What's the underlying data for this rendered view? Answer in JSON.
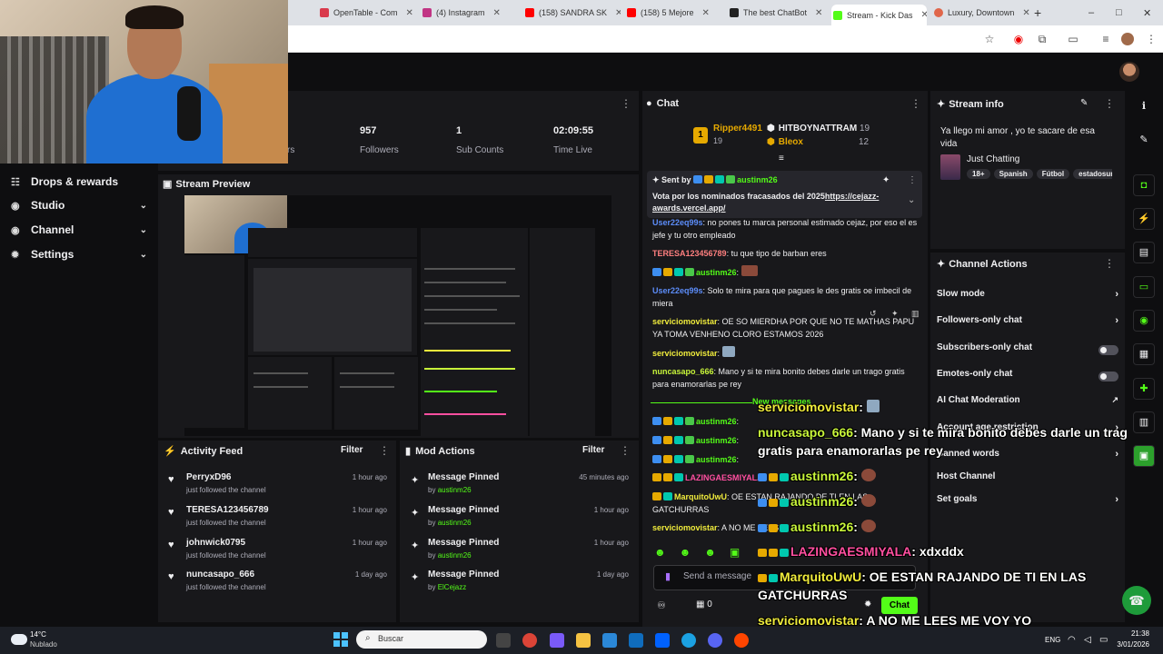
{
  "browser": {
    "tabs": [
      {
        "label": "OpenTable - Com",
        "color": "#d93a4c"
      },
      {
        "label": "(4) Instagram",
        "color": "#c13584"
      },
      {
        "label": "(158) SANDRA SK",
        "color": "#ff0000"
      },
      {
        "label": "(158) 5 Mejore",
        "color": "#ff0000"
      },
      {
        "label": "The best ChatBot",
        "color": "#222222"
      },
      {
        "label": "Stream - Kick Das",
        "color": "#53fc18"
      },
      {
        "label": "Luxury, Downtown",
        "color": "#e0664a"
      }
    ],
    "new_tab": "+",
    "window_controls": [
      "–",
      "□",
      "✕"
    ]
  },
  "sidebar": {
    "items": [
      {
        "label": "Drops & rewards",
        "icon": "gift-icon",
        "glyph": "☷"
      },
      {
        "label": "Studio",
        "icon": "studio-icon",
        "glyph": "◉"
      },
      {
        "label": "Channel",
        "icon": "channel-icon",
        "glyph": "◉"
      },
      {
        "label": "Settings",
        "icon": "gear-icon",
        "glyph": "✹"
      }
    ]
  },
  "stats": {
    "partial_label": "rs",
    "items": [
      {
        "value": "957",
        "label": "Followers"
      },
      {
        "value": "1",
        "label": "Sub Counts"
      },
      {
        "value": "02:09:55",
        "label": "Time Live"
      }
    ]
  },
  "preview": {
    "title": "Stream Preview"
  },
  "activity": {
    "title": "Activity Feed",
    "filter": "Filter",
    "rows": [
      {
        "name": "PerryxD96",
        "sub": "just followed the channel",
        "time": "1 hour ago"
      },
      {
        "name": "TERESA123456789",
        "sub": "just followed the channel",
        "time": "1 hour ago"
      },
      {
        "name": "johnwick0795",
        "sub": "just followed the channel",
        "time": "1 hour ago"
      },
      {
        "name": "nuncasapo_666",
        "sub": "just followed the channel",
        "time": "1 day ago"
      }
    ]
  },
  "mod": {
    "title": "Mod Actions",
    "filter": "Filter",
    "rows": [
      {
        "name": "Message Pinned",
        "by": "by",
        "user": "austinm26",
        "time": "45 minutes ago"
      },
      {
        "name": "Message Pinned",
        "by": "by",
        "user": "austinm26",
        "time": "1 hour ago"
      },
      {
        "name": "Message Pinned",
        "by": "by",
        "user": "austinm26",
        "time": "1 hour ago"
      },
      {
        "name": "Message Pinned",
        "by": "by",
        "user": "ElCejazz",
        "time": "1 day ago"
      }
    ]
  },
  "chat": {
    "title": "Chat",
    "top1": {
      "name": "Ripper4491",
      "count": "19"
    },
    "top2": {
      "name": "HITBOYNATTRAM",
      "count": "19"
    },
    "top3": {
      "name": "Bleox",
      "count": "12"
    },
    "pinned": {
      "sent_by": "Sent by",
      "user": "austinm26",
      "text": "Vota por los nominados fracasados del 2025",
      "link": "https://cejazz-awards.vercel.app/"
    },
    "messages": [
      {
        "user": "User22eq99s",
        "color": "#5c8dfa",
        "text": ": no pones tu marca personal estimado cejaz, por eso el es jefe y tu otro empleado"
      },
      {
        "user": "TERESA123456789",
        "color": "#ff7f7f",
        "text": ": tu que tipo de barban eres"
      },
      {
        "user": "austinm26",
        "color": "#53fc18",
        "text": ":"
      },
      {
        "user": "User22eq99s",
        "color": "#5c8dfa",
        "text": ": Solo te mira para que pagues le des gratis oe imbecil de miera"
      },
      {
        "user": "serviciomovistar",
        "color": "#f0ec3c",
        "text": ": OE SO MIERDHA POR QUE NO TE MATHAS PAPU YA TOMA VENHENO CLORO ESTAMOS 2026"
      },
      {
        "user": "serviciomovistar",
        "color": "#f0ec3c",
        "text": ":"
      },
      {
        "user": "nuncasapo_666",
        "color": "#c8f53a",
        "text": ": Mano y si te mira bonito debes darle un trago gratis para enamorarlas pe rey"
      },
      {
        "user": "austinm26",
        "color": "#53fc18",
        "text": ":"
      },
      {
        "user": "austinm26",
        "color": "#53fc18",
        "text": ":"
      },
      {
        "user": "austinm26",
        "color": "#53fc18",
        "text": ":"
      },
      {
        "user": "LAZINGAESMIYALA",
        "color": "#ff4fa0",
        "text": ":"
      },
      {
        "user": "MarquitoUwU",
        "color": "#f0ec3c",
        "text": ": OE ESTAN RAJANDO DE TI EN LAS GATCHURRAS"
      },
      {
        "user": "serviciomovistar",
        "color": "#f0ec3c",
        "text": ": A NO ME LEES"
      }
    ],
    "new_messages": "New messages",
    "input_placeholder": "Send a message",
    "send_label": "Chat",
    "points": "0"
  },
  "overlay": {
    "lines": [
      {
        "user": "serviciomovistar",
        "text": ":",
        "cls": "ou"
      },
      {
        "user": "nuncasapo_666",
        "text": ": Mano y si te mira bonito debes darle un trago gratis para enamorarlas pe rey",
        "cls": "og"
      },
      {
        "user": "austinm26",
        "text": ":",
        "cls": "og"
      },
      {
        "user": "austinm26",
        "text": ":",
        "cls": "og"
      },
      {
        "user": "austinm26",
        "text": ":",
        "cls": "og"
      },
      {
        "user": "LAZINGAESMIYALA",
        "text": ": xdxddx",
        "cls": "op"
      },
      {
        "user": "MarquitoUwU",
        "text": ": OE ESTAN RAJANDO DE TI EN LAS GATCHURRAS",
        "cls": "ou"
      },
      {
        "user": "serviciomovistar",
        "text": ": A NO ME LEES ME VOY YO LOKEATEMONFUS",
        "cls": "ou"
      }
    ]
  },
  "stream_info": {
    "title": "Stream info",
    "description": "Ya llego mi amor , yo te sacare de esa vida",
    "category": "Just Chatting",
    "tags": [
      "18+",
      "Spanish",
      "Fútbol",
      "estadosun"
    ]
  },
  "channel_actions": {
    "title": "Channel Actions",
    "items": [
      {
        "label": "Slow mode",
        "kind": "chev"
      },
      {
        "label": "Followers-only chat",
        "kind": "chev"
      },
      {
        "label": "Subscribers-only chat",
        "kind": "toggle"
      },
      {
        "label": "Emotes-only chat",
        "kind": "toggle"
      },
      {
        "label": "AI Chat Moderation",
        "kind": "ext"
      },
      {
        "label": "Account age restriction",
        "kind": "chev"
      },
      {
        "label": "Banned words",
        "kind": "chev"
      },
      {
        "label": "Host Channel",
        "kind": "none"
      },
      {
        "label": "Set goals",
        "kind": "chev"
      }
    ]
  },
  "taskbar": {
    "weather_temp": "14°C",
    "weather_desc": "Nublado",
    "search_placeholder": "Buscar",
    "lang": "ENG",
    "time": "21:38",
    "date": "3/01/2026"
  }
}
